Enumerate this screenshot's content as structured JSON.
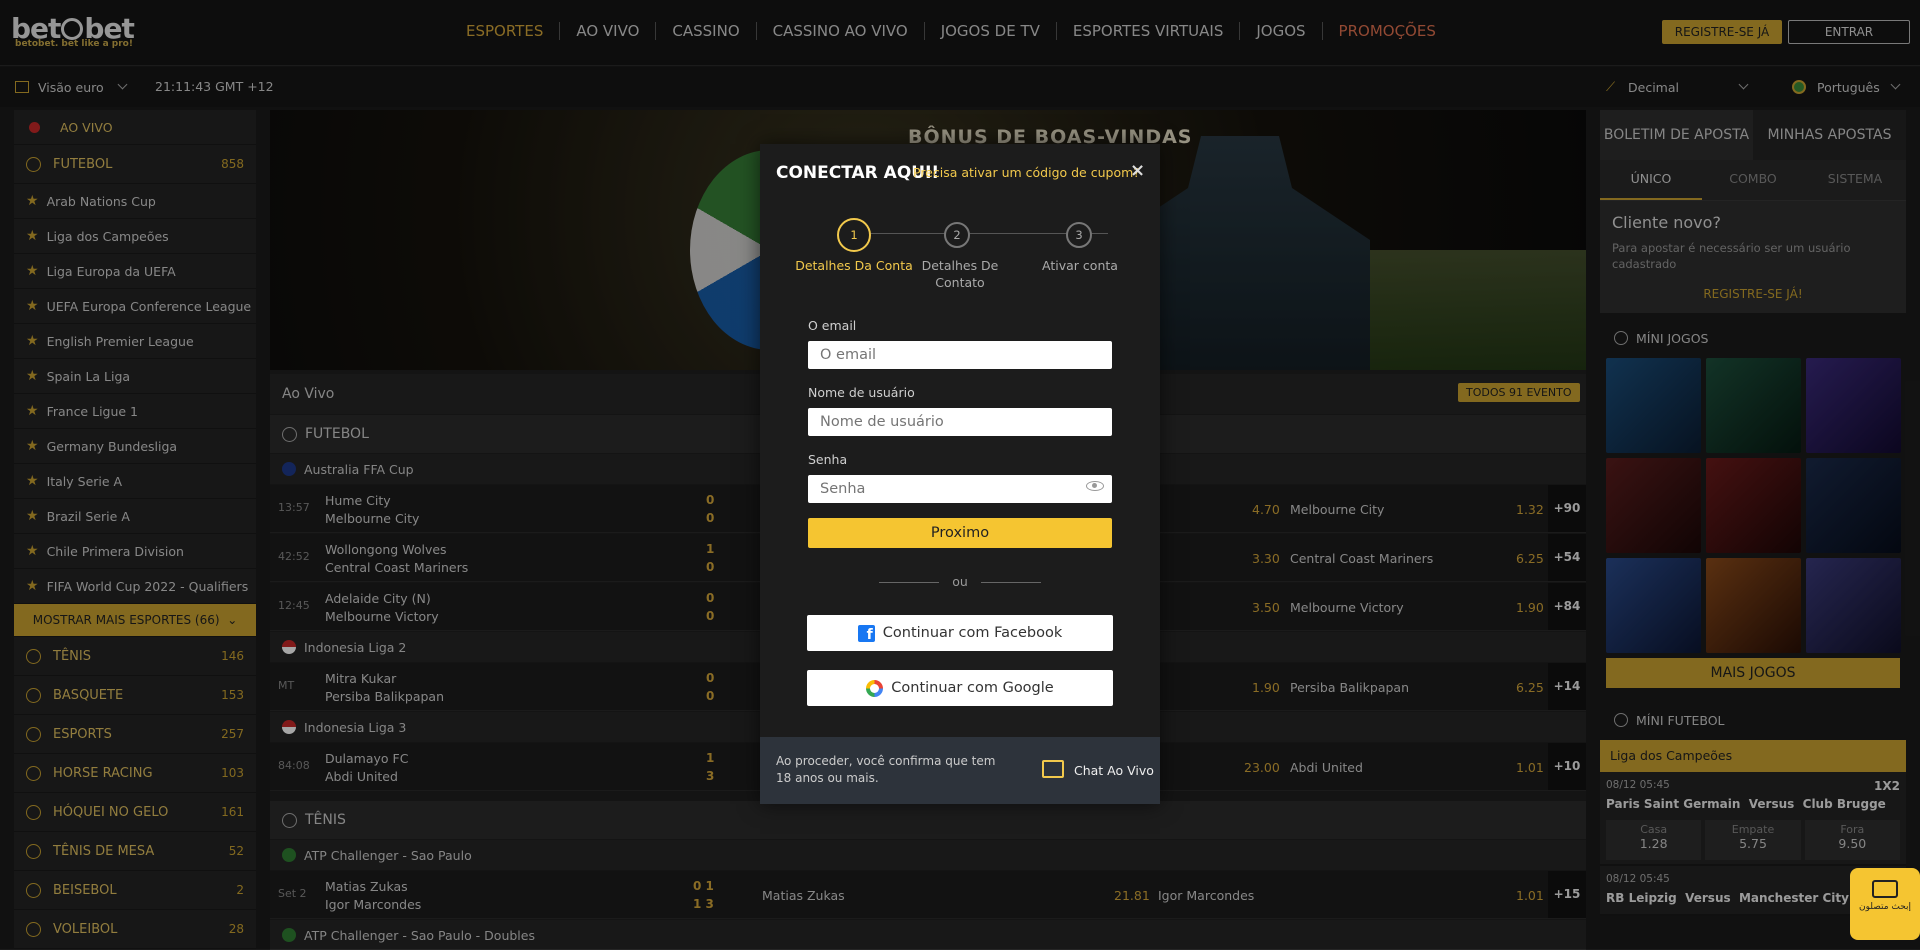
{
  "header": {
    "logo_text_a": "bet",
    "logo_text_b": "bet",
    "tagline": "betobet. bet like a pro!",
    "nav": [
      {
        "label": "ESPORTES",
        "active": true
      },
      {
        "label": "AO VIVO"
      },
      {
        "label": "CASSINO"
      },
      {
        "label": "CASSINO AO VIVO"
      },
      {
        "label": "JOGOS DE TV"
      },
      {
        "label": "ESPORTES VIRTUAIS"
      },
      {
        "label": "JOGOS"
      },
      {
        "label": "PROMOÇÕES",
        "promo": true
      }
    ],
    "register_label": "REGISTRE-SE JÁ",
    "login_label": "ENTRAR"
  },
  "subbar": {
    "view_label": "Visão euro",
    "clock": "21:11:43 GMT +12",
    "odds_format": "Decimal",
    "language": "Português"
  },
  "sidebar": {
    "live_label": "AO VIVO",
    "football_label": "FUTEBOL",
    "football_count": "858",
    "leagues": [
      "Arab Nations Cup",
      "Liga dos Campeões",
      "Liga Europa da UEFA",
      "UEFA Europa Conference League",
      "English Premier League",
      "Spain La Liga",
      "France Ligue 1",
      "Germany Bundesliga",
      "Italy Serie A",
      "Brazil Serie A",
      "Chile Primera Division",
      "FIFA World Cup 2022 - Qualifiers"
    ],
    "more_label": "MOSTRAR MAIS ESPORTES (66)",
    "sports": [
      {
        "label": "TÊNIS",
        "count": "146"
      },
      {
        "label": "BASQUETE",
        "count": "153"
      },
      {
        "label": "ESPORTS",
        "count": "257"
      },
      {
        "label": "HORSE RACING",
        "count": "103"
      },
      {
        "label": "HÓQUEI NO GELO",
        "count": "161"
      },
      {
        "label": "TÊNIS DE MESA",
        "count": "52"
      },
      {
        "label": "BEISEBOL",
        "count": "2"
      },
      {
        "label": "VOLEIBOL",
        "count": "28"
      }
    ]
  },
  "main": {
    "banner_title": "BÔNUS DE BOAS-VINDAS",
    "live_title": "Ao Vivo",
    "all_events": "TODOS 91 EVENTO",
    "football_section": "FUTEBOL",
    "tennis_section": "TÊNIS",
    "leagues": [
      "Australia FFA Cup",
      "Indonesia Liga 2",
      "Indonesia Liga 3",
      "ATP Challenger - Sao Paulo",
      "ATP Challenger - Sao Paulo - Doubles"
    ],
    "matches": [
      {
        "time": "13:57",
        "t1": "Hume City",
        "t2": "Melbourne City",
        "s1": "0",
        "s2": "0",
        "o2": "4.70",
        "away": "Melbourne City",
        "o3": "1.32",
        "more": "+90"
      },
      {
        "time": "42:52",
        "t1": "Wollongong Wolves",
        "t2": "Central Coast Mariners",
        "s1": "1",
        "s2": "0",
        "o2": "3.30",
        "away": "Central Coast Mariners",
        "o3": "6.25",
        "more": "+54"
      },
      {
        "time": "12:45",
        "t1": "Adelaide City (N)",
        "t2": "Melbourne Victory",
        "s1": "0",
        "s2": "0",
        "o2": "3.50",
        "away": "Melbourne Victory",
        "o3": "1.90",
        "more": "+84"
      },
      {
        "time": "MT",
        "t1": "Mitra Kukar",
        "t2": "Persiba Balikpapan",
        "s1": "0",
        "s2": "0",
        "o2": "1.90",
        "away": "Persiba Balikpapan",
        "o3": "6.25",
        "more": "+14"
      },
      {
        "time": "84:08",
        "t1": "Dulamayo FC",
        "t2": "Abdi United",
        "s1": "1",
        "s2": "3",
        "o2": "23.00",
        "away": "Abdi United",
        "o3": "1.01",
        "more": "+10"
      },
      {
        "time": "Set 2",
        "t1": "Matias Zukas",
        "t2": "Igor Marcondes",
        "s1": "0 1",
        "s2": "1 3",
        "home": "Matias Zukas",
        "o1": "21.81",
        "away": "Igor Marcondes",
        "o3": "1.01",
        "more": "+15"
      }
    ]
  },
  "right": {
    "tab_slip": "BOLETIM DE APOSTA",
    "tab_mybets": "MINHAS APOSTAS",
    "sub_single": "ÚNICO",
    "sub_combo": "COMBO",
    "sub_system": "SISTEMA",
    "new_client_title": "Cliente novo?",
    "new_client_text": "Para apostar é necessário ser um usuário cadastrado",
    "new_client_link": "REGISTRE-SE JÁ!",
    "mini_games": "MÍNI JOGOS",
    "more_games": "MAIS JOGOS",
    "mini_football": "MÍNI FUTEBOL",
    "liga": "Liga dos Campeões",
    "match1": {
      "date": "08/12 05:45",
      "market": "1X2",
      "home": "Paris Saint Germain",
      "vs": "Versus",
      "away": "Club Brugge",
      "l1": "Casa",
      "l2": "Empate",
      "l3": "Fora",
      "o1": "1.28",
      "o2": "5.75",
      "o3": "9.50"
    },
    "match2": {
      "date": "08/12 05:45",
      "home": "RB Leipzig",
      "vs": "Versus",
      "away": "Manchester City"
    }
  },
  "modal": {
    "title": "CONECTAR AQUI!",
    "coupon_link": "Precisa ativar um código de cupom?",
    "close": "×",
    "steps": [
      {
        "num": "1",
        "label": "Detalhes Da Conta"
      },
      {
        "num": "2",
        "label": "Detalhes De Contato"
      },
      {
        "num": "3",
        "label": "Ativar conta"
      }
    ],
    "email_label": "O email",
    "email_placeholder": "O email",
    "username_label": "Nome de usuário",
    "username_placeholder": "Nome de usuário",
    "password_label": "Senha",
    "password_placeholder": "Senha",
    "next_label": "Proximo",
    "or_label": "ou",
    "facebook_label": "Continuar com Facebook",
    "google_label": "Continuar com Google",
    "age_notice": "Ao proceder, você confirma que tem 18 anos ou mais.",
    "chat_label": "Chat Ao Vivo"
  },
  "chat_widget": {
    "label": "إبحث متصلون"
  },
  "colors": {
    "accent": "#c9a230",
    "modal_yellow": "#f5c531",
    "promo": "#e0714f"
  }
}
